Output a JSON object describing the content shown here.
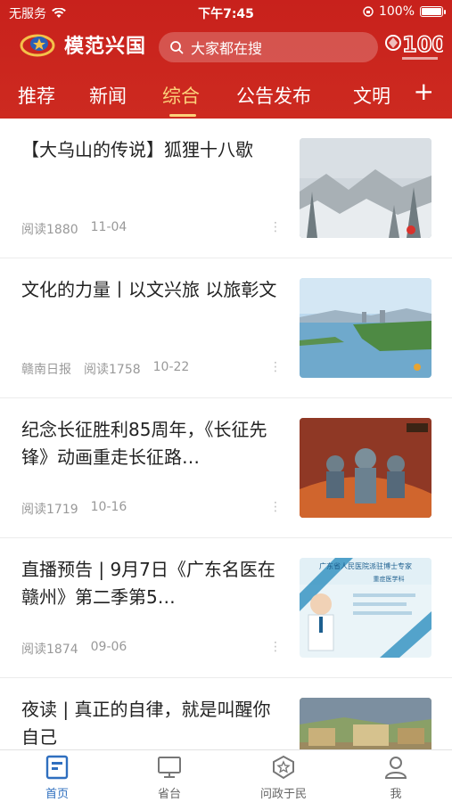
{
  "status": {
    "carrier": "无服务",
    "time": "下午7:45",
    "battery": "100%"
  },
  "header": {
    "logo_text": "模范兴国",
    "search_placeholder": "大家都在搜",
    "colors": {
      "red": "#c8211c",
      "active_tab": "#fcd27b"
    }
  },
  "tabs": [
    {
      "label": "推荐",
      "active": false
    },
    {
      "label": "新闻",
      "active": false
    },
    {
      "label": "综合",
      "active": true
    },
    {
      "label": "公告发布",
      "active": false
    },
    {
      "label": "文明",
      "active": false
    }
  ],
  "add_tab_label": "+",
  "feed": [
    {
      "title": "【大乌山的传说】狐狸十八歇",
      "source": "",
      "reads": "阅读1880",
      "date": "11-04",
      "image": "snowy-mountain-forest"
    },
    {
      "title": "文化的力量丨以文兴旅 以旅彰文",
      "source": "赣南日报",
      "reads": "阅读1758",
      "date": "10-22",
      "image": "lake-and-city"
    },
    {
      "title": "纪念长征胜利85周年，《长征先锋》动画重走长征路…",
      "source": "",
      "reads": "阅读1719",
      "date": "10-16",
      "image": "animated-soldiers"
    },
    {
      "title": "直播预告 | 9月7日《广东名医在赣州》第二季第5…",
      "source": "",
      "reads": "阅读1874",
      "date": "09-06",
      "image": "doctor-poster"
    },
    {
      "title": "夜读 | 真正的自律，就是叫醒你自己",
      "source": "",
      "reads": "",
      "date": "",
      "image": "painting"
    }
  ],
  "thumb_texts": {
    "doctor_poster_title": "广东省人民医院派驻博士专家",
    "doctor_dept": "重症医学科"
  },
  "more_glyph": "⋮",
  "bottom_nav": [
    {
      "label": "首页",
      "icon": "home-news-icon",
      "active": true
    },
    {
      "label": "省台",
      "icon": "tv-monitor-icon",
      "active": false
    },
    {
      "label": "问政于民",
      "icon": "star-badge-icon",
      "active": false
    },
    {
      "label": "我",
      "icon": "user-icon",
      "active": false
    }
  ]
}
